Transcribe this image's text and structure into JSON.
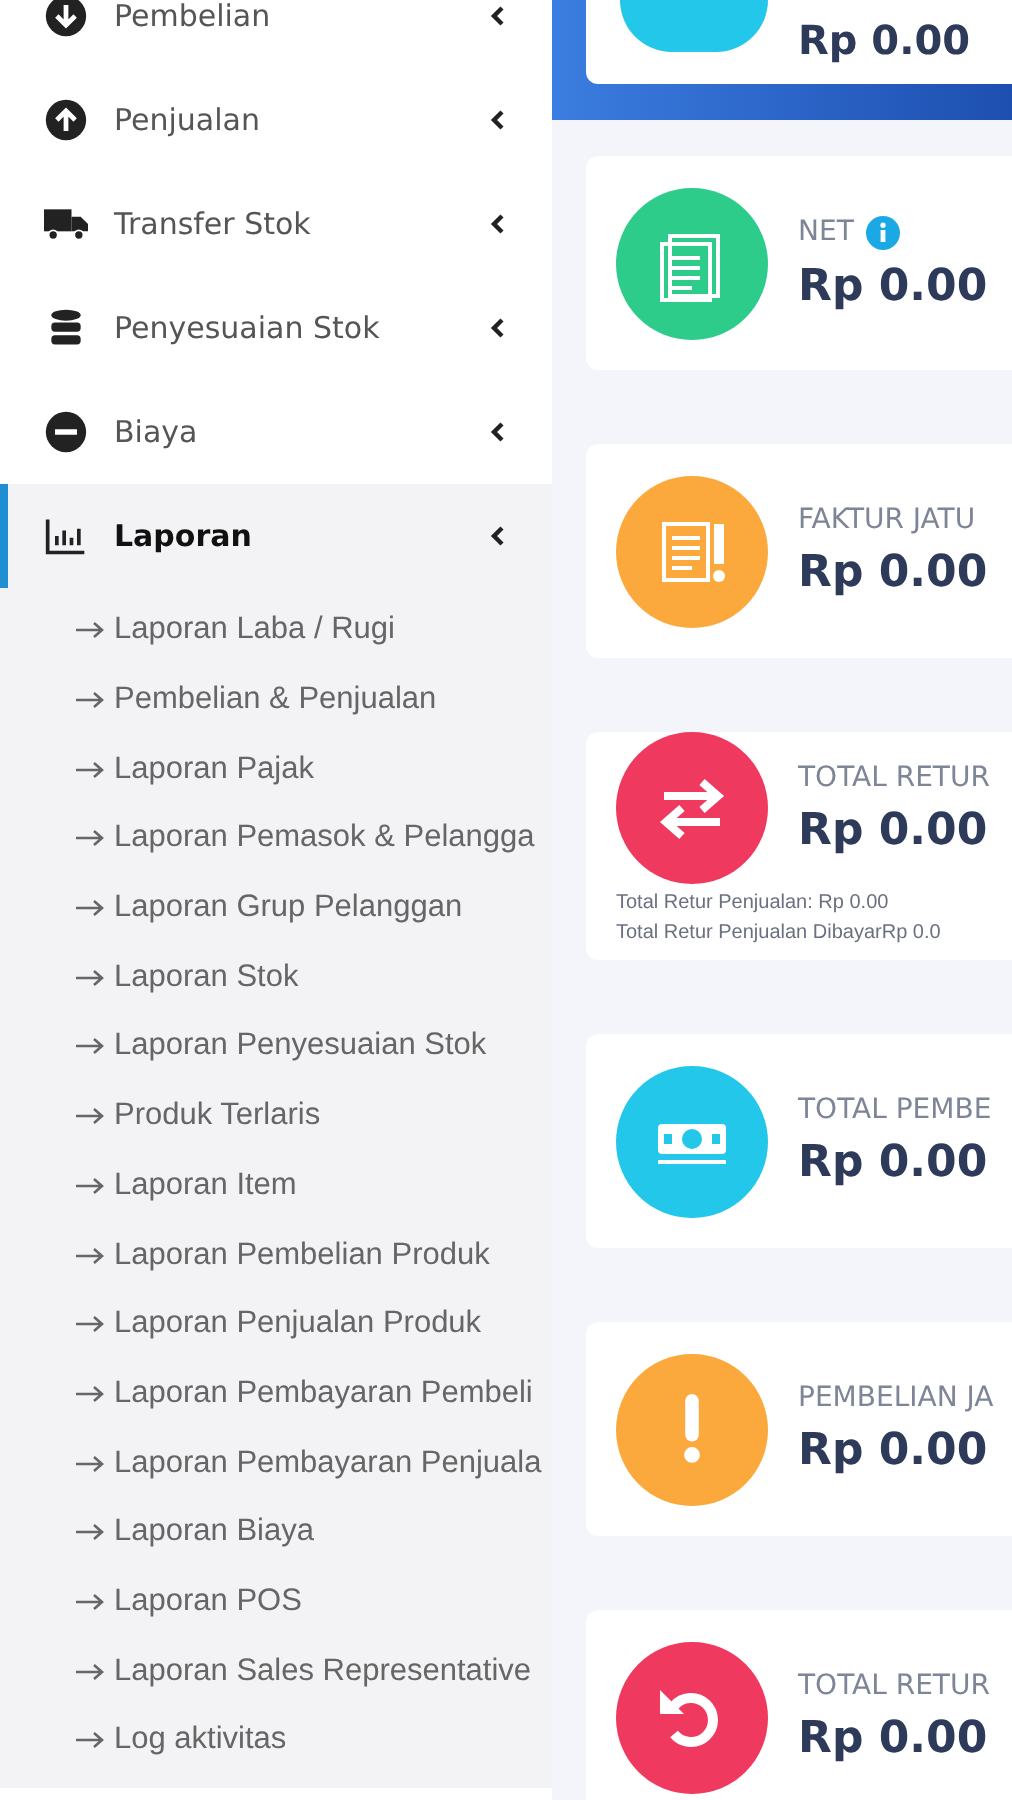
{
  "sidebar": {
    "items": [
      {
        "label": "Pembelian",
        "kind": "down-circle",
        "selected": false
      },
      {
        "label": "Penjualan",
        "kind": "up-circle",
        "selected": false
      },
      {
        "label": "Transfer Stok",
        "kind": "truck",
        "selected": false
      },
      {
        "label": "Penyesuaian Stok",
        "kind": "database",
        "selected": false
      },
      {
        "label": "Biaya",
        "kind": "minus-circle",
        "selected": false
      },
      {
        "label": "Laporan",
        "kind": "chart",
        "selected": true,
        "children": [
          {
            "label": "Laporan Laba / Rugi"
          },
          {
            "label": "Pembelian & Penjualan"
          },
          {
            "label": "Laporan Pajak"
          },
          {
            "label": "Laporan Pemasok & Pelangga"
          },
          {
            "label": "Laporan Grup Pelanggan"
          },
          {
            "label": "Laporan Stok"
          },
          {
            "label": "Laporan Penyesuaian Stok"
          },
          {
            "label": "Produk Terlaris"
          },
          {
            "label": "Laporan Item"
          },
          {
            "label": "Laporan Pembelian Produk"
          },
          {
            "label": "Laporan Penjualan Produk"
          },
          {
            "label": "Laporan Pembayaran Pembeli"
          },
          {
            "label": "Laporan Pembayaran Penjuala"
          },
          {
            "label": "Laporan Biaya"
          },
          {
            "label": "Laporan POS"
          },
          {
            "label": "Laporan Sales Representative"
          },
          {
            "label": "Log aktivitas"
          }
        ]
      }
    ]
  },
  "top_card": {
    "value": "Rp 0.00",
    "color": "#22c7ea"
  },
  "cards": [
    {
      "title": "NET",
      "value": "Rp 0.00",
      "kind": "document",
      "color": "#2ecc8a",
      "info": true
    },
    {
      "title": "FAKTUR JATU",
      "value": "Rp 0.00",
      "kind": "document-alert",
      "color": "#fba93c",
      "info": false
    },
    {
      "title": "TOTAL RETUR",
      "value": "Rp 0.00",
      "kind": "exchange",
      "color": "#f0395f",
      "info": false,
      "notes": [
        "Total Retur Penjualan: Rp 0.00",
        "Total Retur Penjualan DibayarRp 0.0"
      ]
    },
    {
      "title": "TOTAL PEMBE",
      "value": "Rp 0.00",
      "kind": "money",
      "color": "#22c7ea",
      "info": false
    },
    {
      "title": "PEMBELIAN JA",
      "value": "Rp 0.00",
      "kind": "alert",
      "color": "#fba93c",
      "info": false
    },
    {
      "title": "TOTAL RETUR",
      "value": "Rp 0.00",
      "kind": "undo",
      "color": "#f0395f",
      "info": false
    }
  ]
}
